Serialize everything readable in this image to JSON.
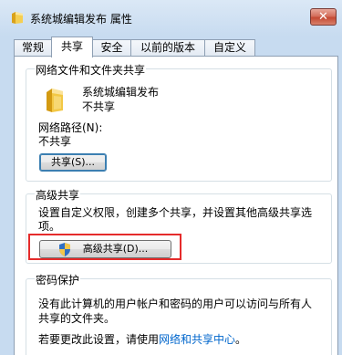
{
  "window": {
    "title": "系统城编辑发布 属性",
    "close_label": "✕"
  },
  "tabs": [
    {
      "label": "常规"
    },
    {
      "label": "共享"
    },
    {
      "label": "安全"
    },
    {
      "label": "以前的版本"
    },
    {
      "label": "自定义"
    }
  ],
  "network_sharing": {
    "title": "网络文件和文件夹共享",
    "folder_name": "系统城编辑发布",
    "share_state": "不共享",
    "path_label": "网络路径(N):",
    "path_value": "不共享",
    "share_button": "共享(S)..."
  },
  "advanced_sharing": {
    "title": "高级共享",
    "description_line1": "设置自定义权限，创建多个共享，并设置其他高级共享选",
    "description_line2": "项。",
    "button": "高级共享(D)..."
  },
  "password_protection": {
    "title": "密码保护",
    "line1": "没有此计算机的用户帐户和密码的用户可以访问与所有人",
    "line2": "共享的文件夹。",
    "change_prefix": "若要更改此设置，请使用",
    "change_link": "网络和共享中心",
    "change_suffix": "。"
  },
  "colors": {
    "highlight": "#e52b2b",
    "link": "#0066cc"
  }
}
